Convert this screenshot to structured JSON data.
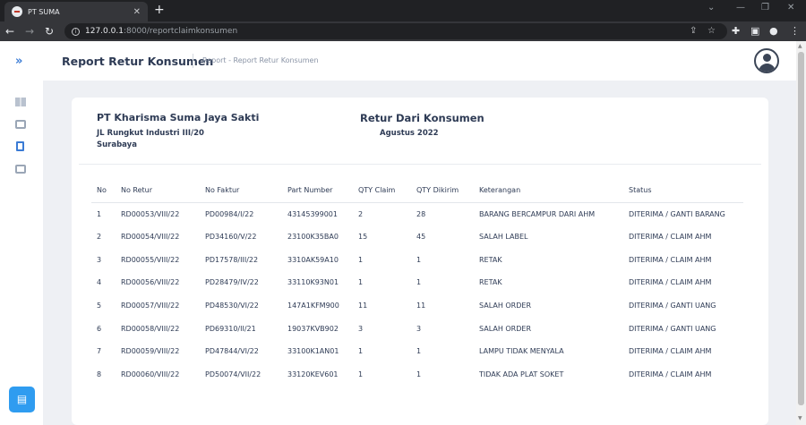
{
  "browser": {
    "tab_title": "PT SUMA",
    "url_host": "127.0.0.1",
    "url_path": ":8000/reportclaimkonsumen"
  },
  "header": {
    "title": "Report Retur Konsumen",
    "breadcrumb": "Report - Report Retur Konsumen"
  },
  "report": {
    "company": "PT Kharisma Suma Jaya Sakti",
    "address_line1": "JL Rungkut Industri III/20",
    "address_line2": "Surabaya",
    "title": "Retur Dari Konsumen",
    "period": "Agustus 2022"
  },
  "table": {
    "headers": [
      "No",
      "No Retur",
      "No Faktur",
      "Part Number",
      "QTY Claim",
      "QTY Dikirim",
      "Keterangan",
      "Status"
    ],
    "rows": [
      [
        "1",
        "RD00053/VIII/22",
        "PD00984/I/22",
        "43145399001",
        "2",
        "28",
        "BARANG BERCAMPUR DARI AHM",
        "DITERIMA / GANTI BARANG"
      ],
      [
        "2",
        "RD00054/VIII/22",
        "PD34160/V/22",
        "23100K35BA0",
        "15",
        "45",
        "SALAH LABEL",
        "DITERIMA / CLAIM AHM"
      ],
      [
        "3",
        "RD00055/VIII/22",
        "PD17578/III/22",
        "3310AK59A10",
        "1",
        "1",
        "RETAK",
        "DITERIMA / CLAIM AHM"
      ],
      [
        "4",
        "RD00056/VIII/22",
        "PD28479/IV/22",
        "33110K93N01",
        "1",
        "1",
        "RETAK",
        "DITERIMA / CLAIM AHM"
      ],
      [
        "5",
        "RD00057/VIII/22",
        "PD48530/VI/22",
        "147A1KFM900",
        "11",
        "11",
        "SALAH ORDER",
        "DITERIMA / GANTI UANG"
      ],
      [
        "6",
        "RD00058/VIII/22",
        "PD69310/II/21",
        "19037KVB902",
        "3",
        "3",
        "SALAH ORDER",
        "DITERIMA / GANTI UANG"
      ],
      [
        "7",
        "RD00059/VIII/22",
        "PD47844/VI/22",
        "33100K1AN01",
        "1",
        "1",
        "LAMPU TIDAK MENYALA",
        "DITERIMA / CLAIM AHM"
      ],
      [
        "8",
        "RD00060/VIII/22",
        "PD50074/VII/22",
        "33120KEV601",
        "1",
        "1",
        "TIDAK ADA PLAT SOKET",
        "DITERIMA / CLAIM AHM"
      ]
    ]
  }
}
